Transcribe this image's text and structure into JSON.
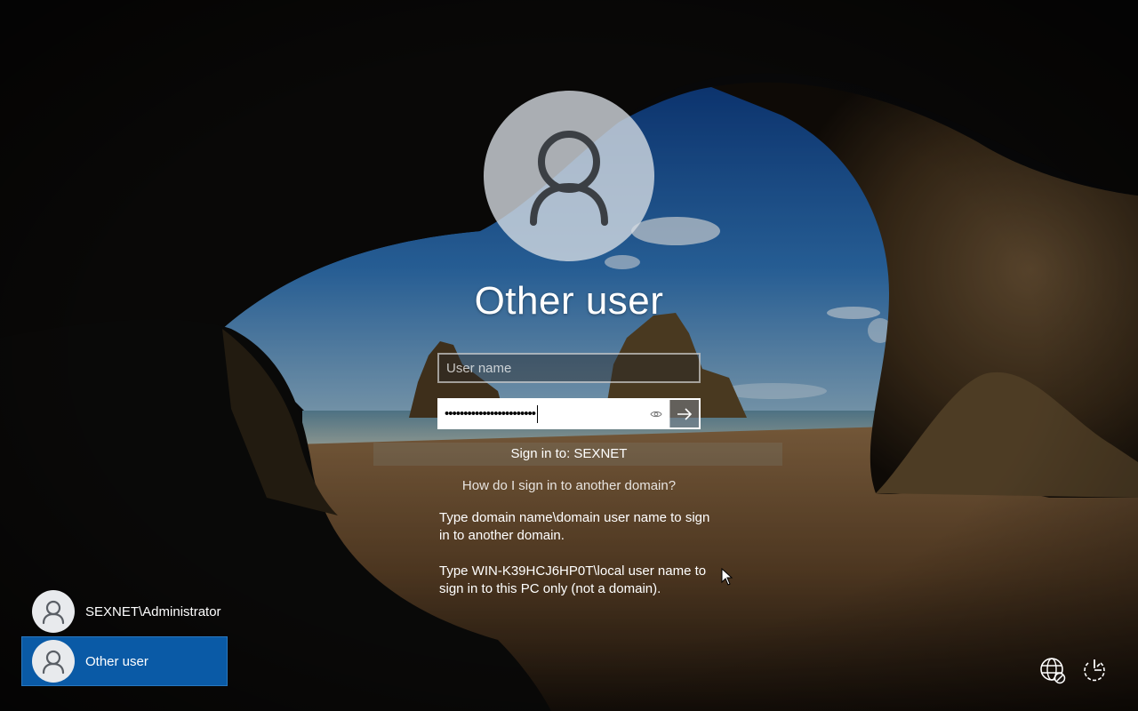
{
  "login": {
    "title": "Other user",
    "username_placeholder": "User name",
    "username_value": "",
    "password_mask": "••••••••••••••••••••••••",
    "sign_in_to": "Sign in to: SEXNET",
    "domain_link": "How do I sign in to another domain?",
    "help_domain": "Type domain name\\domain user name to sign in to another domain.",
    "help_local": "Type WIN-K39HCJ6HP0T\\local user name to sign in to this PC only (not a domain)."
  },
  "users": [
    {
      "label": "SEXNET\\Administrator",
      "selected": false
    },
    {
      "label": "Other user",
      "selected": true
    }
  ],
  "icons": {
    "avatar": "person-icon",
    "reveal": "eye-icon",
    "submit": "arrow-right-icon",
    "network": "globe-disconnected-icon",
    "power": "ease-of-access-power-icon"
  },
  "colors": {
    "selected_user_bg": "#0a5aa6",
    "sky": "#1f5fa8",
    "rock": "#3a2a16"
  }
}
